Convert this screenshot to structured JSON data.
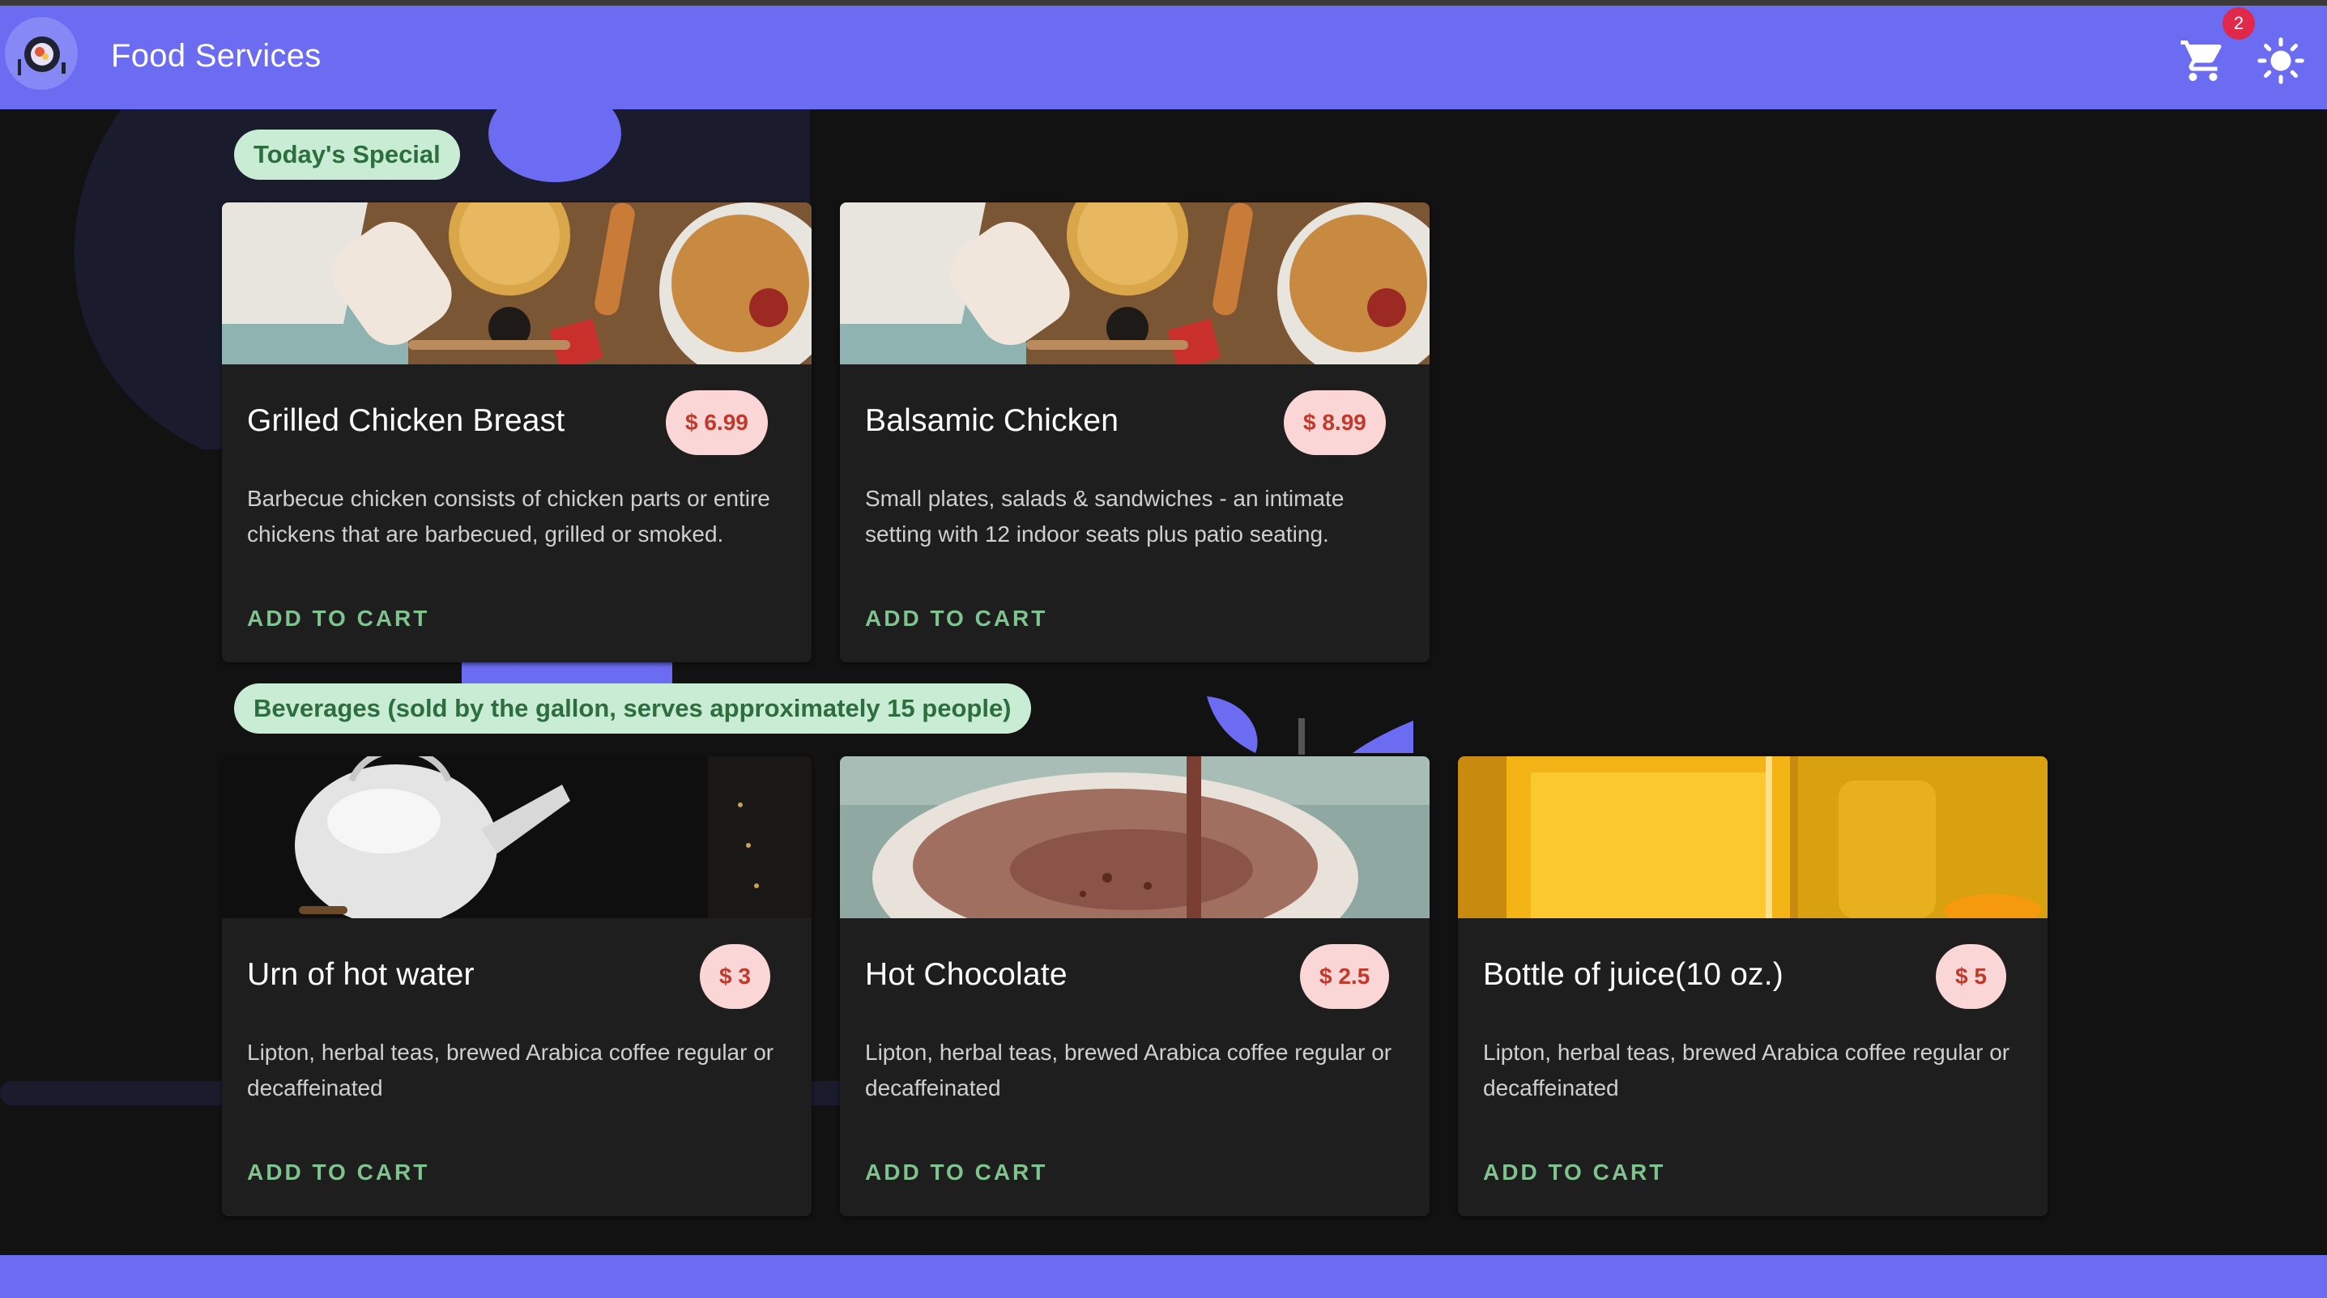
{
  "app": {
    "title": "Food Services",
    "cart_count": "2",
    "accent_color": "#6b6cf2"
  },
  "sections": [
    {
      "label": "Today's Special",
      "items": [
        {
          "name": "Grilled Chicken Breast",
          "price": "$ 6.99",
          "description": "Barbecue chicken consists of chicken parts or entire chickens that are barbecued, grilled or smoked.",
          "action": "ADD TO CART",
          "image": "pastry-table-photo"
        },
        {
          "name": "Balsamic Chicken",
          "price": "$ 8.99",
          "description": "Small plates, salads & sandwiches - an intimate setting with 12 indoor seats plus patio seating.",
          "action": "ADD TO CART",
          "image": "pastry-table-photo"
        }
      ]
    },
    {
      "label": "Beverages (sold by the gallon, serves approximately 15 people)",
      "items": [
        {
          "name": "Urn of hot water",
          "price": "$ 3",
          "description": "Lipton, herbal teas, brewed Arabica coffee regular or decaffeinated",
          "action": "ADD TO CART",
          "image": "kettle-photo"
        },
        {
          "name": "Hot Chocolate",
          "price": "$ 2.5",
          "description": "Lipton, herbal teas, brewed Arabica coffee regular or decaffeinated",
          "action": "ADD TO CART",
          "image": "hot-chocolate-photo"
        },
        {
          "name": "Bottle of juice(10 oz.)",
          "price": "$ 5",
          "description": "Lipton, herbal teas, brewed Arabica coffee regular or decaffeinated",
          "action": "ADD TO CART",
          "image": "orange-juice-photo"
        }
      ]
    }
  ]
}
